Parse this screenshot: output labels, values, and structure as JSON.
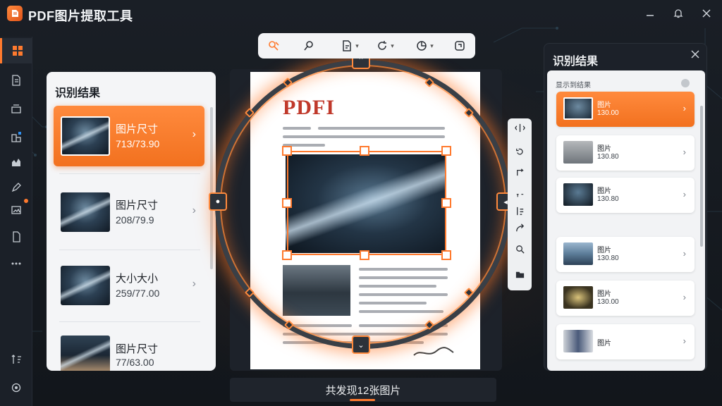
{
  "app": {
    "title": "PDF图片提取工具"
  },
  "left_panel": {
    "title": "识别结果",
    "items": [
      {
        "name": "图片尺寸",
        "size": "713/73.90",
        "selected": true
      },
      {
        "name": "图片尺寸",
        "size": "208/79.9",
        "selected": false
      },
      {
        "name": "大小大小",
        "size": "259/77.00",
        "selected": false
      },
      {
        "name": "图片尺寸",
        "size": "77/63.00",
        "selected": false
      }
    ]
  },
  "document": {
    "heading": "PDFI"
  },
  "status": {
    "text": "共发现12张图片"
  },
  "right_panel": {
    "title": "识别结果",
    "subtitle": "显示到结果",
    "items": [
      {
        "name": "图片",
        "size": "130.00",
        "selected": true
      },
      {
        "name": "图片",
        "size": "130.80",
        "selected": false
      },
      {
        "name": "图片",
        "size": "130.80",
        "selected": false
      },
      {
        "name": "图片",
        "size": "130.80",
        "selected": false
      },
      {
        "name": "图片",
        "size": "130.00",
        "selected": false
      },
      {
        "name": "图片",
        "size": "",
        "selected": false
      }
    ]
  },
  "icons": {
    "left_rail": [
      "grid-icon",
      "document-icon",
      "stack-icon",
      "layers-icon",
      "chart-icon",
      "pen-icon",
      "image-icon",
      "page-icon",
      "more-icon",
      "sort-icon",
      "settings-icon"
    ],
    "toolbar": [
      "select-icon",
      "search-icon",
      "file-icon",
      "rotate-icon",
      "pie-icon",
      "crop-icon"
    ],
    "vertical_toolbar": [
      "flip-icon",
      "rotate-left-icon",
      "rotate-right-icon",
      "text-icon",
      "align-icon",
      "redo-icon",
      "zoom-icon",
      "folder-icon"
    ]
  },
  "colors": {
    "accent": "#ff7a2e",
    "background": "#15191f",
    "panel": "#f4f5f7"
  }
}
